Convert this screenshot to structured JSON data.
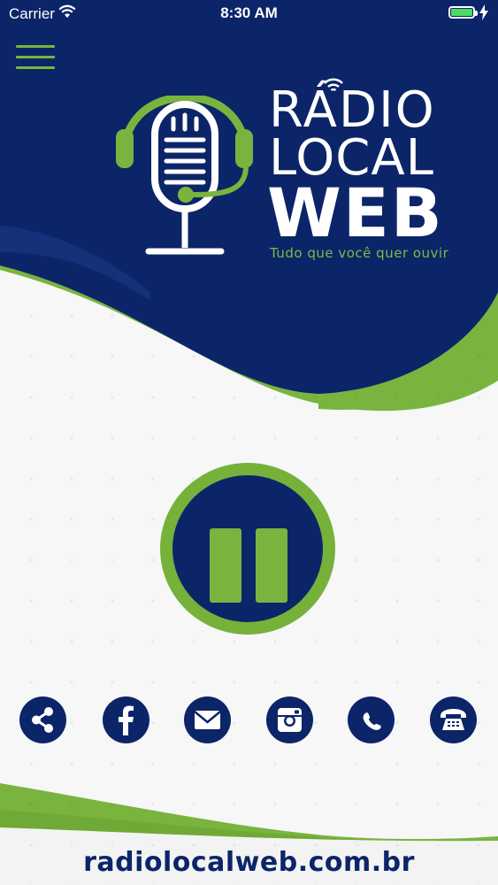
{
  "status_bar": {
    "carrier": "Carrier",
    "time": "8:30 AM",
    "battery_icon": "battery-full-icon",
    "wifi_icon": "wifi-icon"
  },
  "header": {
    "menu_icon": "hamburger-menu-icon",
    "logo_icon": "microphone-headset-icon",
    "brand_line1": "RÁDIO",
    "brand_line2": "LOCAL",
    "brand_line3": "WEB",
    "slogan": "Tudo que você quer ouvir"
  },
  "player": {
    "state": "playing",
    "button_icon": "pause-icon"
  },
  "social": [
    {
      "id": "share",
      "icon": "share-icon"
    },
    {
      "id": "facebook",
      "icon": "facebook-icon"
    },
    {
      "id": "email",
      "icon": "email-icon"
    },
    {
      "id": "instagram",
      "icon": "instagram-icon"
    },
    {
      "id": "whatsapp",
      "icon": "whatsapp-icon"
    },
    {
      "id": "phone",
      "icon": "telephone-icon"
    }
  ],
  "footer": {
    "url": "radiolocalweb.com.br"
  },
  "colors": {
    "navy": "#0c2569",
    "green": "#79b43f",
    "background": "#f7f7f7",
    "white": "#ffffff"
  }
}
